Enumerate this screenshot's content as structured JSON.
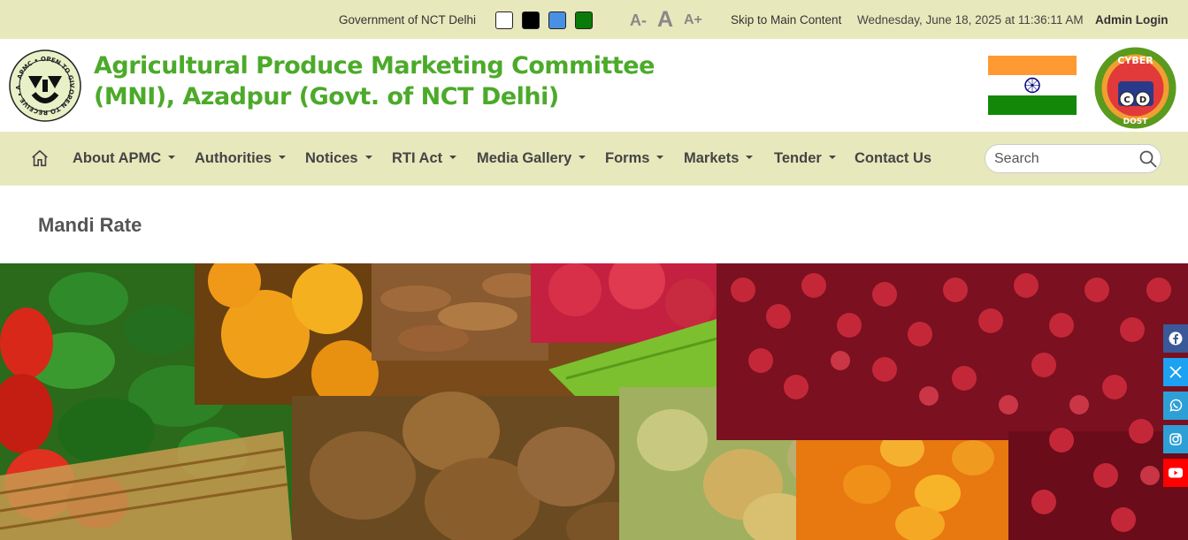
{
  "topbar": {
    "government": "Government of NCT Delhi",
    "theme_colors": [
      "#ffffff",
      "#000000",
      "#4a90e2",
      "#0a7a0a"
    ],
    "font_decrease": "A-",
    "font_reset": "A",
    "font_increase": "A+",
    "skip_link": "Skip to Main Content",
    "datetime": "Wednesday, June 18, 2025 at 11:36:11 AM",
    "admin_login": "Admin Login"
  },
  "header": {
    "title_line1": "Agricultural Produce Marketing Committee",
    "title_line2": "(MNI), Azadpur (Govt. of NCT Delhi)",
    "logo": {
      "text_top": "APMC • OPEN TO GIVE",
      "text_bottom": "OPEN TO RECEIVE • AZADPUR"
    },
    "cyber_badge": {
      "top": "CYBER",
      "bottom": "DOST",
      "c": "C",
      "d": "D"
    },
    "flag_colors": {
      "saffron": "#ff9933",
      "white": "#ffffff",
      "green": "#138808",
      "chakra": "#000080"
    }
  },
  "nav": {
    "items": [
      {
        "label": "About APMC",
        "dropdown": true
      },
      {
        "label": "Authorities",
        "dropdown": true
      },
      {
        "label": "Notices",
        "dropdown": true
      },
      {
        "label": "RTI Act",
        "dropdown": true
      },
      {
        "label": "Media Gallery",
        "dropdown": true
      },
      {
        "label": "Forms",
        "dropdown": true
      },
      {
        "label": "Markets",
        "dropdown": true
      },
      {
        "label": "Tender",
        "dropdown": true
      },
      {
        "label": "Contact Us",
        "dropdown": false
      }
    ],
    "search_placeholder": "Search"
  },
  "page": {
    "title": "Mandi Rate"
  },
  "social": [
    {
      "icon": "facebook-icon",
      "color": "#3b5998"
    },
    {
      "icon": "x-icon",
      "color": "#1da1f2"
    },
    {
      "icon": "whatsapp-icon",
      "color": "#2e9fd6"
    },
    {
      "icon": "instagram-icon",
      "color": "#2e9fd6"
    },
    {
      "icon": "youtube-icon",
      "color": "#ff0000"
    }
  ]
}
